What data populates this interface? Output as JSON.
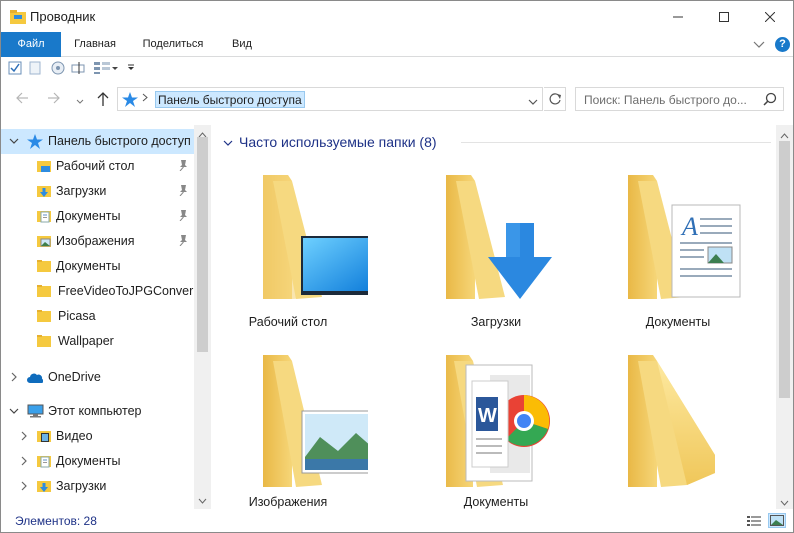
{
  "window": {
    "title": "Проводник"
  },
  "ribbon": {
    "tabs": [
      {
        "label": "Файл"
      },
      {
        "label": "Главная"
      },
      {
        "label": "Поделиться"
      },
      {
        "label": "Вид"
      }
    ],
    "help_label": "?"
  },
  "address": {
    "breadcrumb": "Панель быстрого доступа",
    "search_placeholder": "Поиск: Панель быстрого до..."
  },
  "nav_pane": {
    "quick_access": "Панель быстрого доступ",
    "items": [
      {
        "label": "Рабочий стол",
        "pinned": true
      },
      {
        "label": "Загрузки",
        "pinned": true
      },
      {
        "label": "Документы",
        "pinned": true
      },
      {
        "label": "Изображения",
        "pinned": true
      },
      {
        "label": "Документы",
        "pinned": false
      },
      {
        "label": "FreeVideoToJPGConver",
        "pinned": false
      },
      {
        "label": "Picasa",
        "pinned": false
      },
      {
        "label": "Wallpaper",
        "pinned": false
      }
    ],
    "onedrive": "OneDrive",
    "this_pc": "Этот компьютер",
    "pc_items": [
      {
        "label": "Видео"
      },
      {
        "label": "Документы"
      },
      {
        "label": "Загрузки"
      }
    ]
  },
  "content": {
    "group_title": "Часто используемые папки (8)",
    "folders": [
      {
        "label": "Рабочий стол",
        "icon": "desktop-folder-icon"
      },
      {
        "label": "Загрузки",
        "icon": "downloads-folder-icon"
      },
      {
        "label": "Документы",
        "icon": "documents-folder-icon"
      },
      {
        "label": "Изображения",
        "icon": "pictures-folder-icon"
      },
      {
        "label": "Документы",
        "icon": "office-documents-folder-icon"
      },
      {
        "label": "",
        "icon": "plain-folder-icon"
      }
    ]
  },
  "status": {
    "items_count": "Элементов: 28"
  },
  "colors": {
    "accent": "#1979ca",
    "selection": "#cce8ff",
    "folder": "#f8d775",
    "link": "#1e3287"
  }
}
